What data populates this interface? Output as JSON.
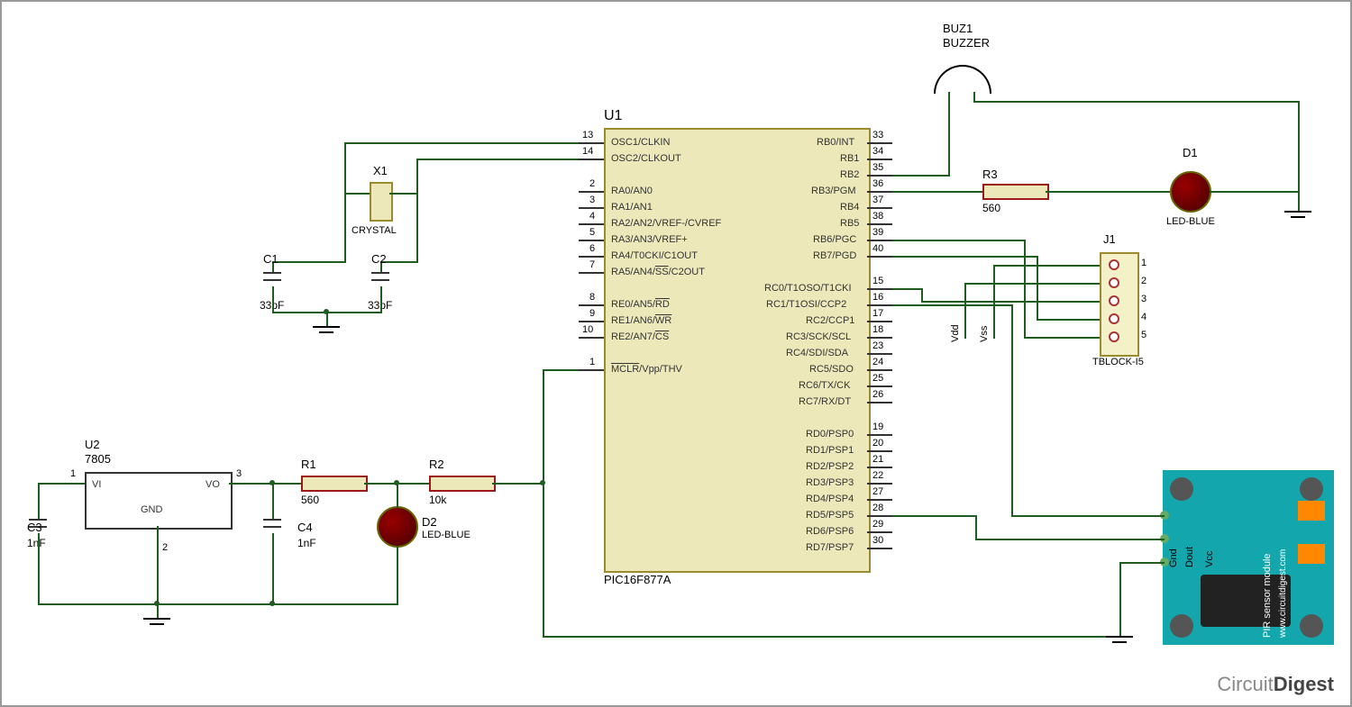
{
  "components": {
    "u1": {
      "ref": "U1",
      "name": "PIC16F877A"
    },
    "u2": {
      "ref": "U2",
      "name": "7805",
      "pins": {
        "vi": "VI",
        "vo": "VO",
        "gnd": "GND",
        "p1": "1",
        "p2": "2",
        "p3": "3"
      }
    },
    "x1": {
      "ref": "X1",
      "name": "CRYSTAL"
    },
    "c1": {
      "ref": "C1",
      "val": "33pF"
    },
    "c2": {
      "ref": "C2",
      "val": "33pF"
    },
    "c3": {
      "ref": "C3",
      "val": "1nF"
    },
    "c4": {
      "ref": "C4",
      "val": "1nF"
    },
    "r1": {
      "ref": "R1",
      "val": "560"
    },
    "r2": {
      "ref": "R2",
      "val": "10k"
    },
    "r3": {
      "ref": "R3",
      "val": "560"
    },
    "d1": {
      "ref": "D1",
      "name": "LED-BLUE"
    },
    "d2": {
      "ref": "D2",
      "name": "LED-BLUE"
    },
    "buz1": {
      "ref": "BUZ1",
      "name": "BUZZER"
    },
    "j1": {
      "ref": "J1",
      "name": "TBLOCK-I5",
      "pins": [
        "1",
        "2",
        "3",
        "4",
        "5"
      ]
    },
    "pir": {
      "name": "PIR sensor module",
      "site": "www.circuitdigest.com",
      "pins": {
        "gnd": "Gnd",
        "dout": "Dout",
        "vcc": "Vcc"
      }
    }
  },
  "nets": {
    "vdd": "Vdd",
    "vss": "Vss"
  },
  "mcu_pins_left": [
    {
      "n": "13",
      "t": "OSC1/CLKIN"
    },
    {
      "n": "14",
      "t": "OSC2/CLKOUT"
    },
    {
      "n": "2",
      "t": "RA0/AN0"
    },
    {
      "n": "3",
      "t": "RA1/AN1"
    },
    {
      "n": "4",
      "t": "RA2/AN2/VREF-/CVREF"
    },
    {
      "n": "5",
      "t": "RA3/AN3/VREF+"
    },
    {
      "n": "6",
      "t": "RA4/T0CKI/C1OUT"
    },
    {
      "n": "7",
      "t": "RA5/AN4/SS/C2OUT"
    },
    {
      "n": "8",
      "t": "RE0/AN5/RD"
    },
    {
      "n": "9",
      "t": "RE1/AN6/WR"
    },
    {
      "n": "10",
      "t": "RE2/AN7/CS"
    },
    {
      "n": "1",
      "t": "MCLR/Vpp/THV"
    }
  ],
  "mcu_pins_right": [
    {
      "n": "33",
      "t": "RB0/INT"
    },
    {
      "n": "34",
      "t": "RB1"
    },
    {
      "n": "35",
      "t": "RB2"
    },
    {
      "n": "36",
      "t": "RB3/PGM"
    },
    {
      "n": "37",
      "t": "RB4"
    },
    {
      "n": "38",
      "t": "RB5"
    },
    {
      "n": "39",
      "t": "RB6/PGC"
    },
    {
      "n": "40",
      "t": "RB7/PGD"
    },
    {
      "n": "15",
      "t": "RC0/T1OSO/T1CKI"
    },
    {
      "n": "16",
      "t": "RC1/T1OSI/CCP2"
    },
    {
      "n": "17",
      "t": "RC2/CCP1"
    },
    {
      "n": "18",
      "t": "RC3/SCK/SCL"
    },
    {
      "n": "23",
      "t": "RC4/SDI/SDA"
    },
    {
      "n": "24",
      "t": "RC5/SDO"
    },
    {
      "n": "25",
      "t": "RC6/TX/CK"
    },
    {
      "n": "26",
      "t": "RC7/RX/DT"
    },
    {
      "n": "19",
      "t": "RD0/PSP0"
    },
    {
      "n": "20",
      "t": "RD1/PSP1"
    },
    {
      "n": "21",
      "t": "RD2/PSP2"
    },
    {
      "n": "22",
      "t": "RD3/PSP3"
    },
    {
      "n": "27",
      "t": "RD4/PSP4"
    },
    {
      "n": "28",
      "t": "RD5/PSP5"
    },
    {
      "n": "29",
      "t": "RD6/PSP6"
    },
    {
      "n": "30",
      "t": "RD7/PSP7"
    }
  ],
  "brand": {
    "a": "Circuit",
    "b": "Digest"
  }
}
